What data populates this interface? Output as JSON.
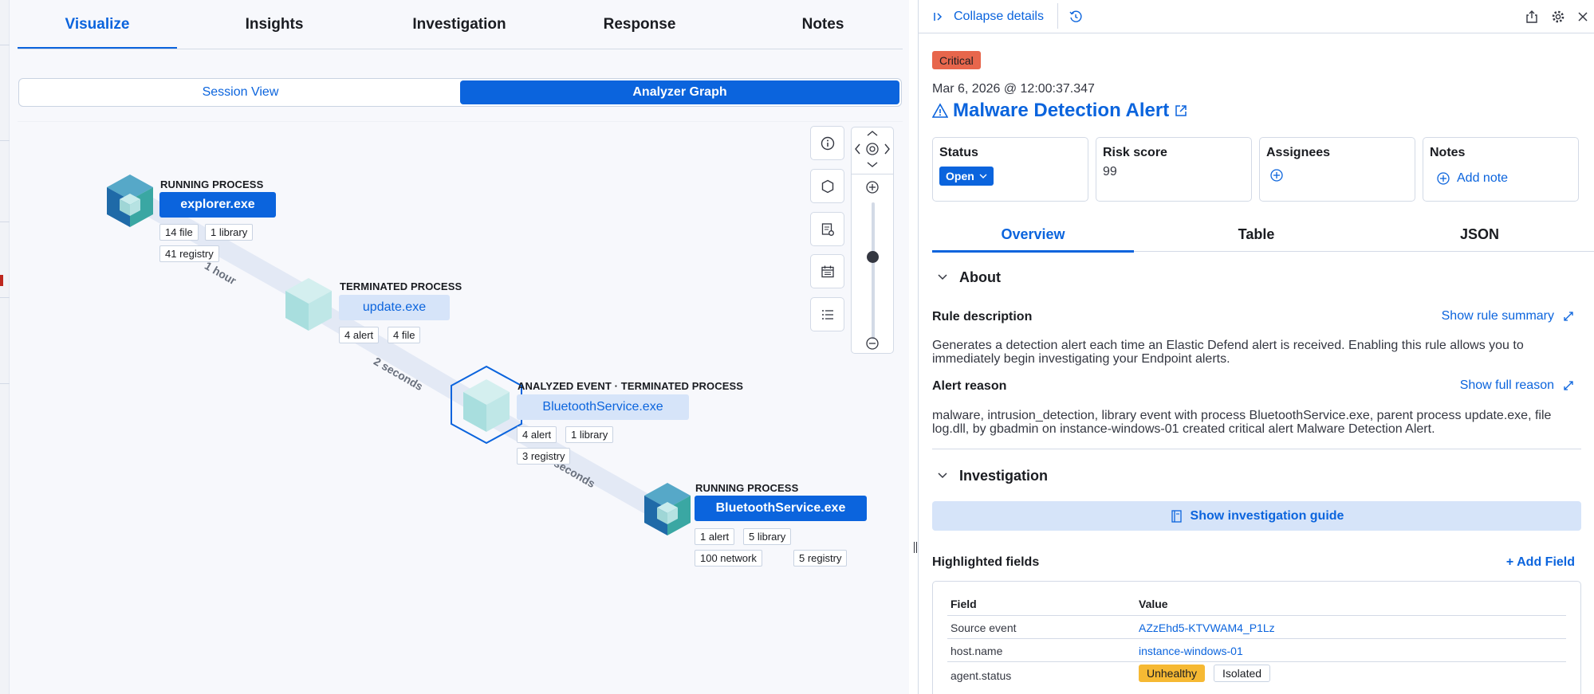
{
  "tabs": [
    {
      "label": "Visualize",
      "active": true
    },
    {
      "label": "Insights",
      "active": false
    },
    {
      "label": "Investigation",
      "active": false
    },
    {
      "label": "Response",
      "active": false
    },
    {
      "label": "Notes",
      "active": false
    }
  ],
  "view_toggle": {
    "session": "Session View",
    "analyzer": "Analyzer Graph",
    "selected": "Analyzer Graph"
  },
  "graph": {
    "edge_labels": [
      "1 hour",
      "2 seconds",
      "3 seconds"
    ],
    "nodes": [
      {
        "type": "RUNNING PROCESS",
        "name": "explorer.exe",
        "badges": [
          "14 file",
          "1 library",
          "41 registry"
        ]
      },
      {
        "type": "TERMINATED PROCESS",
        "name": "update.exe",
        "badges": [
          "4 alert",
          "4 file"
        ]
      },
      {
        "type": "ANALYZED EVENT · TERMINATED PROCESS",
        "name": "BluetoothService.exe",
        "badges": [
          "4 alert",
          "1 library",
          "3 registry"
        ]
      },
      {
        "type": "RUNNING PROCESS",
        "name": "BluetoothService.exe",
        "badges": [
          "1 alert",
          "5 library",
          "100 network",
          "5 registry"
        ]
      }
    ],
    "controls": [
      "info-icon",
      "hexagon-icon",
      "table-settings-icon",
      "calendar-icon",
      "list-icon"
    ]
  },
  "details": {
    "collapse_label": "Collapse details",
    "severity": "Critical",
    "timestamp": "Mar 6, 2026 @ 12:00:37.347",
    "title": "Malware Detection Alert",
    "cards": {
      "status_label": "Status",
      "status_value": "Open",
      "risk_label": "Risk score",
      "risk_value": "99",
      "assignees_label": "Assignees",
      "notes_label": "Notes",
      "add_note": "Add note"
    },
    "sub_tabs": [
      {
        "label": "Overview",
        "active": true
      },
      {
        "label": "Table",
        "active": false
      },
      {
        "label": "JSON",
        "active": false
      }
    ],
    "about": {
      "heading": "About",
      "rule_description_label": "Rule description",
      "show_rule_summary": "Show rule summary",
      "rule_description": "Generates a detection alert each time an Elastic Defend alert is received. Enabling this rule allows you to immediately begin investigating your Endpoint alerts.",
      "alert_reason_label": "Alert reason",
      "show_full_reason": "Show full reason",
      "alert_reason": "malware, intrusion_detection, library event with process BluetoothService.exe, parent process update.exe, file log.dll, by gbadmin on instance-windows-01 created critical alert Malware Detection Alert."
    },
    "investigation": {
      "heading": "Investigation",
      "guide_button": "Show investigation guide"
    },
    "highlighted": {
      "heading": "Highlighted fields",
      "add_field": "+ Add Field",
      "col_field": "Field",
      "col_value": "Value",
      "rows": [
        {
          "field": "Source event",
          "value": "AZzEhd5-KTVWAM4_P1Lz"
        },
        {
          "field": "host.name",
          "value": "instance-windows-01"
        },
        {
          "field": "agent.status",
          "value": "",
          "badges": [
            "Unhealthy",
            "Isolated"
          ]
        }
      ]
    }
  }
}
